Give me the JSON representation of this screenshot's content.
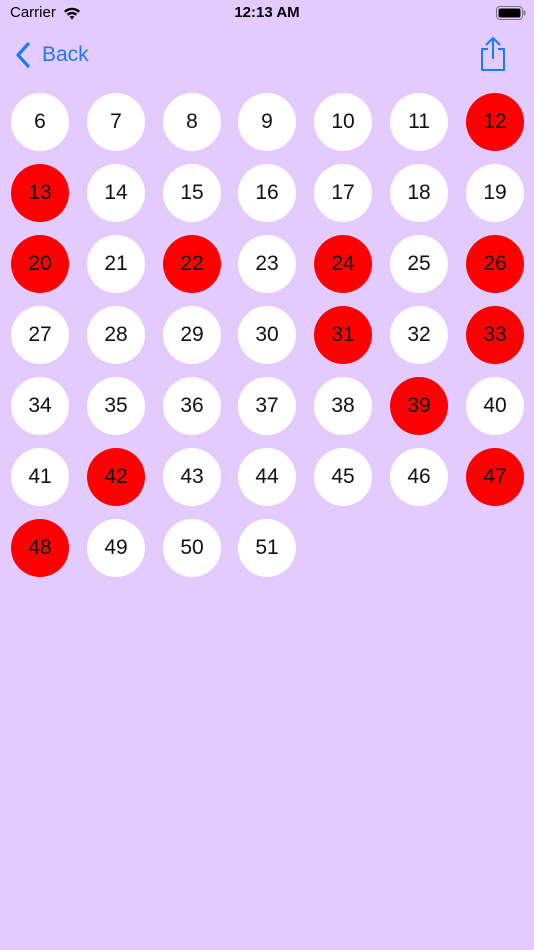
{
  "status_bar": {
    "carrier": "Carrier",
    "time": "12:13 AM",
    "wifi_icon": "wifi-icon",
    "battery_icon": "battery-icon"
  },
  "nav": {
    "back_label": "Back",
    "back_icon": "chevron-left-icon",
    "share_icon": "share-icon",
    "accent_color": "#1a7cf5"
  },
  "colors": {
    "background": "#e4cbff",
    "ball": "#ffffff",
    "ball_selected": "#fe0000"
  },
  "balls": [
    {
      "label": "6",
      "selected": false
    },
    {
      "label": "7",
      "selected": false
    },
    {
      "label": "8",
      "selected": false
    },
    {
      "label": "9",
      "selected": false
    },
    {
      "label": "10",
      "selected": false
    },
    {
      "label": "11",
      "selected": false
    },
    {
      "label": "12",
      "selected": true
    },
    {
      "label": "13",
      "selected": true
    },
    {
      "label": "14",
      "selected": false
    },
    {
      "label": "15",
      "selected": false
    },
    {
      "label": "16",
      "selected": false
    },
    {
      "label": "17",
      "selected": false
    },
    {
      "label": "18",
      "selected": false
    },
    {
      "label": "19",
      "selected": false
    },
    {
      "label": "20",
      "selected": true
    },
    {
      "label": "21",
      "selected": false
    },
    {
      "label": "22",
      "selected": true
    },
    {
      "label": "23",
      "selected": false
    },
    {
      "label": "24",
      "selected": true
    },
    {
      "label": "25",
      "selected": false
    },
    {
      "label": "26",
      "selected": true
    },
    {
      "label": "27",
      "selected": false
    },
    {
      "label": "28",
      "selected": false
    },
    {
      "label": "29",
      "selected": false
    },
    {
      "label": "30",
      "selected": false
    },
    {
      "label": "31",
      "selected": true
    },
    {
      "label": "32",
      "selected": false
    },
    {
      "label": "33",
      "selected": true
    },
    {
      "label": "34",
      "selected": false
    },
    {
      "label": "35",
      "selected": false
    },
    {
      "label": "36",
      "selected": false
    },
    {
      "label": "37",
      "selected": false
    },
    {
      "label": "38",
      "selected": false
    },
    {
      "label": "39",
      "selected": true
    },
    {
      "label": "40",
      "selected": false
    },
    {
      "label": "41",
      "selected": false
    },
    {
      "label": "42",
      "selected": true
    },
    {
      "label": "43",
      "selected": false
    },
    {
      "label": "44",
      "selected": false
    },
    {
      "label": "45",
      "selected": false
    },
    {
      "label": "46",
      "selected": false
    },
    {
      "label": "47",
      "selected": true
    },
    {
      "label": "48",
      "selected": true
    },
    {
      "label": "49",
      "selected": false
    },
    {
      "label": "50",
      "selected": false
    },
    {
      "label": "51",
      "selected": false
    }
  ]
}
